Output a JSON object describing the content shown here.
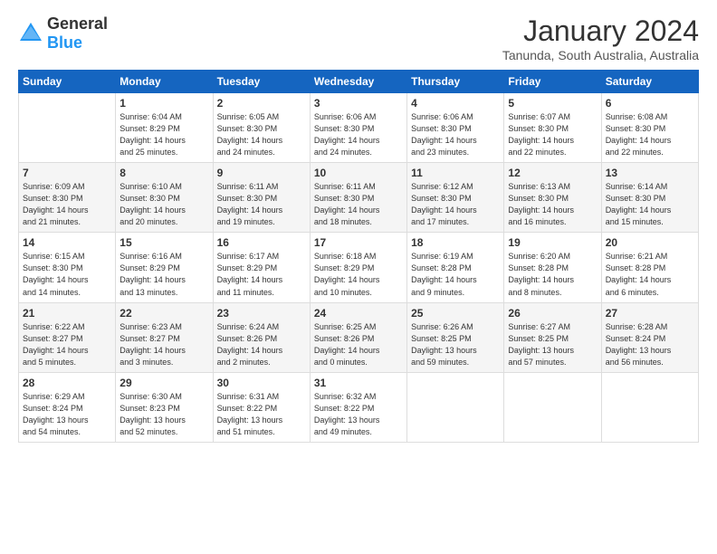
{
  "header": {
    "logo_general": "General",
    "logo_blue": "Blue",
    "title": "January 2024",
    "subtitle": "Tanunda, South Australia, Australia"
  },
  "days_of_week": [
    "Sunday",
    "Monday",
    "Tuesday",
    "Wednesday",
    "Thursday",
    "Friday",
    "Saturday"
  ],
  "weeks": [
    [
      {
        "day": "",
        "info": ""
      },
      {
        "day": "1",
        "info": "Sunrise: 6:04 AM\nSunset: 8:29 PM\nDaylight: 14 hours\nand 25 minutes."
      },
      {
        "day": "2",
        "info": "Sunrise: 6:05 AM\nSunset: 8:30 PM\nDaylight: 14 hours\nand 24 minutes."
      },
      {
        "day": "3",
        "info": "Sunrise: 6:06 AM\nSunset: 8:30 PM\nDaylight: 14 hours\nand 24 minutes."
      },
      {
        "day": "4",
        "info": "Sunrise: 6:06 AM\nSunset: 8:30 PM\nDaylight: 14 hours\nand 23 minutes."
      },
      {
        "day": "5",
        "info": "Sunrise: 6:07 AM\nSunset: 8:30 PM\nDaylight: 14 hours\nand 22 minutes."
      },
      {
        "day": "6",
        "info": "Sunrise: 6:08 AM\nSunset: 8:30 PM\nDaylight: 14 hours\nand 22 minutes."
      }
    ],
    [
      {
        "day": "7",
        "info": "Sunrise: 6:09 AM\nSunset: 8:30 PM\nDaylight: 14 hours\nand 21 minutes."
      },
      {
        "day": "8",
        "info": "Sunrise: 6:10 AM\nSunset: 8:30 PM\nDaylight: 14 hours\nand 20 minutes."
      },
      {
        "day": "9",
        "info": "Sunrise: 6:11 AM\nSunset: 8:30 PM\nDaylight: 14 hours\nand 19 minutes."
      },
      {
        "day": "10",
        "info": "Sunrise: 6:11 AM\nSunset: 8:30 PM\nDaylight: 14 hours\nand 18 minutes."
      },
      {
        "day": "11",
        "info": "Sunrise: 6:12 AM\nSunset: 8:30 PM\nDaylight: 14 hours\nand 17 minutes."
      },
      {
        "day": "12",
        "info": "Sunrise: 6:13 AM\nSunset: 8:30 PM\nDaylight: 14 hours\nand 16 minutes."
      },
      {
        "day": "13",
        "info": "Sunrise: 6:14 AM\nSunset: 8:30 PM\nDaylight: 14 hours\nand 15 minutes."
      }
    ],
    [
      {
        "day": "14",
        "info": "Sunrise: 6:15 AM\nSunset: 8:30 PM\nDaylight: 14 hours\nand 14 minutes."
      },
      {
        "day": "15",
        "info": "Sunrise: 6:16 AM\nSunset: 8:29 PM\nDaylight: 14 hours\nand 13 minutes."
      },
      {
        "day": "16",
        "info": "Sunrise: 6:17 AM\nSunset: 8:29 PM\nDaylight: 14 hours\nand 11 minutes."
      },
      {
        "day": "17",
        "info": "Sunrise: 6:18 AM\nSunset: 8:29 PM\nDaylight: 14 hours\nand 10 minutes."
      },
      {
        "day": "18",
        "info": "Sunrise: 6:19 AM\nSunset: 8:28 PM\nDaylight: 14 hours\nand 9 minutes."
      },
      {
        "day": "19",
        "info": "Sunrise: 6:20 AM\nSunset: 8:28 PM\nDaylight: 14 hours\nand 8 minutes."
      },
      {
        "day": "20",
        "info": "Sunrise: 6:21 AM\nSunset: 8:28 PM\nDaylight: 14 hours\nand 6 minutes."
      }
    ],
    [
      {
        "day": "21",
        "info": "Sunrise: 6:22 AM\nSunset: 8:27 PM\nDaylight: 14 hours\nand 5 minutes."
      },
      {
        "day": "22",
        "info": "Sunrise: 6:23 AM\nSunset: 8:27 PM\nDaylight: 14 hours\nand 3 minutes."
      },
      {
        "day": "23",
        "info": "Sunrise: 6:24 AM\nSunset: 8:26 PM\nDaylight: 14 hours\nand 2 minutes."
      },
      {
        "day": "24",
        "info": "Sunrise: 6:25 AM\nSunset: 8:26 PM\nDaylight: 14 hours\nand 0 minutes."
      },
      {
        "day": "25",
        "info": "Sunrise: 6:26 AM\nSunset: 8:25 PM\nDaylight: 13 hours\nand 59 minutes."
      },
      {
        "day": "26",
        "info": "Sunrise: 6:27 AM\nSunset: 8:25 PM\nDaylight: 13 hours\nand 57 minutes."
      },
      {
        "day": "27",
        "info": "Sunrise: 6:28 AM\nSunset: 8:24 PM\nDaylight: 13 hours\nand 56 minutes."
      }
    ],
    [
      {
        "day": "28",
        "info": "Sunrise: 6:29 AM\nSunset: 8:24 PM\nDaylight: 13 hours\nand 54 minutes."
      },
      {
        "day": "29",
        "info": "Sunrise: 6:30 AM\nSunset: 8:23 PM\nDaylight: 13 hours\nand 52 minutes."
      },
      {
        "day": "30",
        "info": "Sunrise: 6:31 AM\nSunset: 8:22 PM\nDaylight: 13 hours\nand 51 minutes."
      },
      {
        "day": "31",
        "info": "Sunrise: 6:32 AM\nSunset: 8:22 PM\nDaylight: 13 hours\nand 49 minutes."
      },
      {
        "day": "",
        "info": ""
      },
      {
        "day": "",
        "info": ""
      },
      {
        "day": "",
        "info": ""
      }
    ]
  ]
}
